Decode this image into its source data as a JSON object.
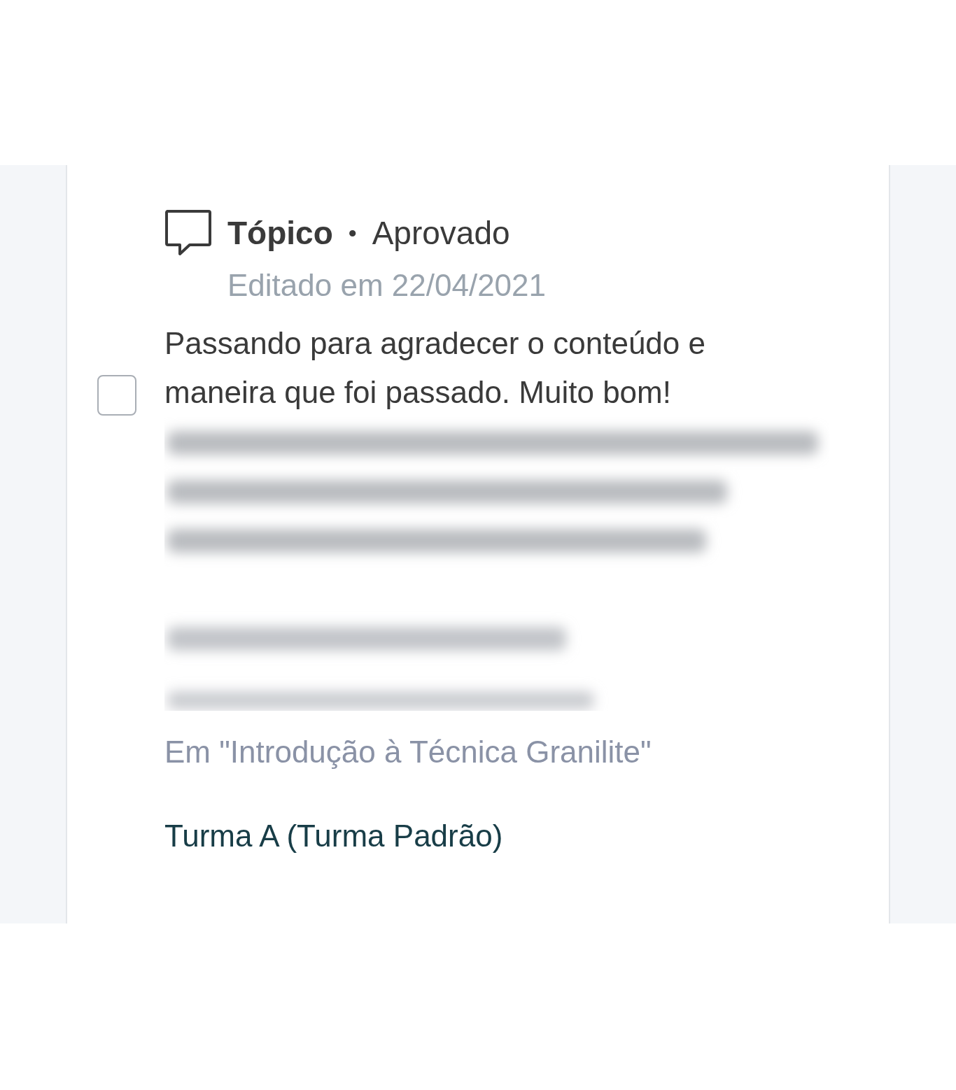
{
  "post": {
    "type": "Tópico",
    "separator": "•",
    "status": "Aprovado",
    "edited": "Editado em 22/04/2021",
    "checked": false,
    "body": "Passando para agradecer o conteúdo e maneira que foi passado. Muito bom!",
    "course": "Em \"Introdução à Técnica Granilite\"",
    "class_name": "Turma A (Turma Padrão)"
  }
}
